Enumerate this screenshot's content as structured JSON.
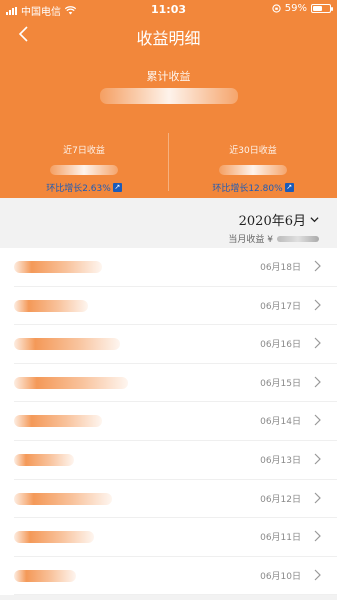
{
  "status_bar": {
    "carrier": "中国电信",
    "time": "11:03",
    "battery": "59%",
    "battery_level": 0.59
  },
  "header": {
    "title": "收益明细",
    "total_label": "累计收益",
    "stats": [
      {
        "label": "近7日收益",
        "growth": "环比增长2.63%"
      },
      {
        "label": "近30日收益",
        "growth": "环比增长12.80%"
      }
    ]
  },
  "month": {
    "selected": "2020年6月",
    "total_label": "当月收益 ¥"
  },
  "rows": [
    {
      "date": "06月18日"
    },
    {
      "date": "06月17日"
    },
    {
      "date": "06月16日"
    },
    {
      "date": "06月15日"
    },
    {
      "date": "06月14日"
    },
    {
      "date": "06月13日"
    },
    {
      "date": "06月12日"
    },
    {
      "date": "06月11日"
    },
    {
      "date": "06月10日"
    }
  ],
  "colors": {
    "accent": "#f2873b",
    "growth_text": "#1c5bb8"
  }
}
